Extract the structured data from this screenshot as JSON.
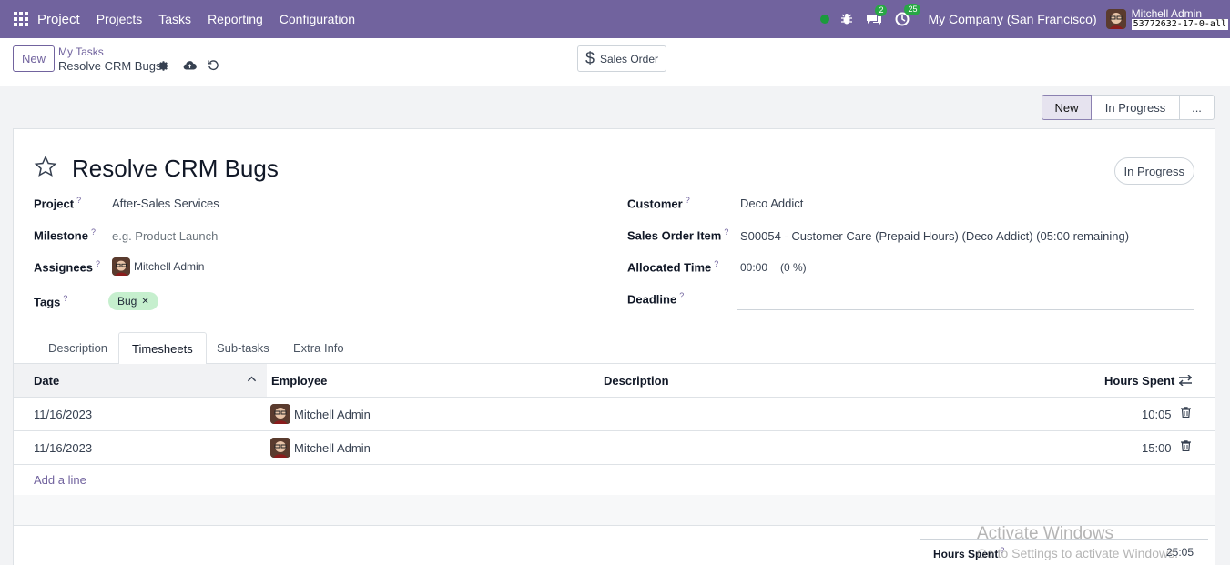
{
  "navbar": {
    "brand": "Project",
    "menus": [
      "Projects",
      "Tasks",
      "Reporting",
      "Configuration"
    ],
    "chat_count": "2",
    "activity_count": "25",
    "company": "My Company (San Francisco)",
    "user_name": "Mitchell Admin",
    "db_name": "53772632-17-0-all"
  },
  "control": {
    "new_label": "New",
    "breadcrumb_parent": "My Tasks",
    "breadcrumb_current": "Resolve CRM Bugs",
    "sales_order_label": "Sales Order"
  },
  "statusbar": {
    "stages": [
      "New",
      "In Progress",
      "..."
    ],
    "active": "New"
  },
  "form": {
    "title": "Resolve CRM Bugs",
    "stage_pill": "In Progress",
    "fields": {
      "project_label": "Project",
      "project_value": "After-Sales Services",
      "milestone_label": "Milestone",
      "milestone_placeholder": "e.g. Product Launch",
      "assignees_label": "Assignees",
      "assignee_value": "Mitchell Admin",
      "tags_label": "Tags",
      "tag_value": "Bug",
      "customer_label": "Customer",
      "customer_value": "Deco Addict",
      "so_item_label": "Sales Order Item",
      "so_item_value": "S00054 - Customer Care (Prepaid Hours) (Deco Addict) (05:00 remaining)",
      "allocated_label": "Allocated Time",
      "allocated_value": "00:00",
      "allocated_percent": "(0 %)",
      "deadline_label": "Deadline",
      "help_mark": "?"
    },
    "tabs": [
      "Description",
      "Timesheets",
      "Sub-tasks",
      "Extra Info"
    ],
    "active_tab": "Timesheets"
  },
  "timesheets": {
    "columns": [
      "Date",
      "Employee",
      "Description",
      "Hours Spent"
    ],
    "rows": [
      {
        "date": "11/16/2023",
        "employee": "Mitchell Admin",
        "description": "",
        "hours": "10:05"
      },
      {
        "date": "11/16/2023",
        "employee": "Mitchell Admin",
        "description": "",
        "hours": "15:00"
      }
    ],
    "add_line": "Add a line",
    "total_label": "Hours Spent",
    "total_value": "25:05"
  },
  "watermark": {
    "line1": "Activate Windows",
    "line2": "Go to Settings to activate Windows."
  },
  "colors": {
    "brand": "#71639e",
    "tag_green": "#c6efce",
    "online_green": "#1b9a3d"
  }
}
